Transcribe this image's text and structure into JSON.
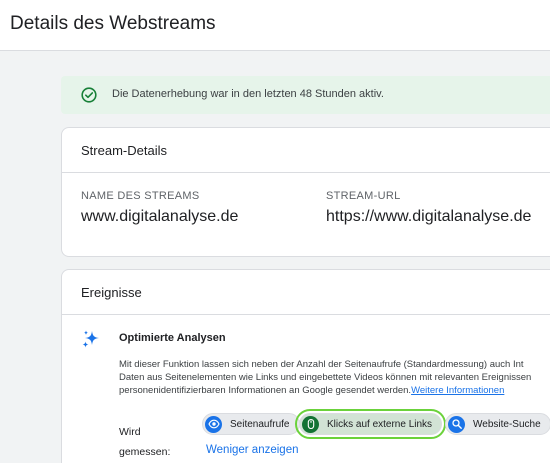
{
  "page": {
    "title": "Details des Webstreams"
  },
  "banner": {
    "text": "Die Datenerhebung war in den letzten 48 Stunden aktiv.",
    "icon": "check-circle-icon",
    "color": "#188038"
  },
  "stream_details": {
    "title": "Stream-Details",
    "name_label": "NAME DES STREAMS",
    "name_value": "www.digitalanalyse.de",
    "url_label": "STREAM-URL",
    "url_value": "https://www.digitalanalyse.de"
  },
  "events": {
    "title": "Ereignisse",
    "feature_title": "Optimierte Analysen",
    "feature_icon": "sparkle-icon",
    "desc_line1": "Mit dieser Funktion lassen sich neben der Anzahl der Seitenaufrufe (Standardmessung) auch Int",
    "desc_line2": "Daten aus Seitenelementen wie Links und eingebettete Videos können mit relevanten Ereignissen",
    "desc_line3": "personenidentifizierbaren Informationen an Google gesendet werden.",
    "more_info_link": "Weitere Informationen",
    "measured_label_line1": "Wird",
    "measured_label_line2": "gemessen:",
    "chips": [
      {
        "label": "Seitenaufrufe",
        "icon": "eye-icon"
      },
      {
        "label": "Klicks auf externe Links",
        "icon": "mouse-icon",
        "selected": true
      },
      {
        "label": "Website-Suche",
        "icon": "search-icon"
      }
    ],
    "less_link": "Weniger anzeigen"
  },
  "colors": {
    "accent": "#1a73e8",
    "highlight": "#6bd23b",
    "banner_bg": "#e6f4ea"
  }
}
